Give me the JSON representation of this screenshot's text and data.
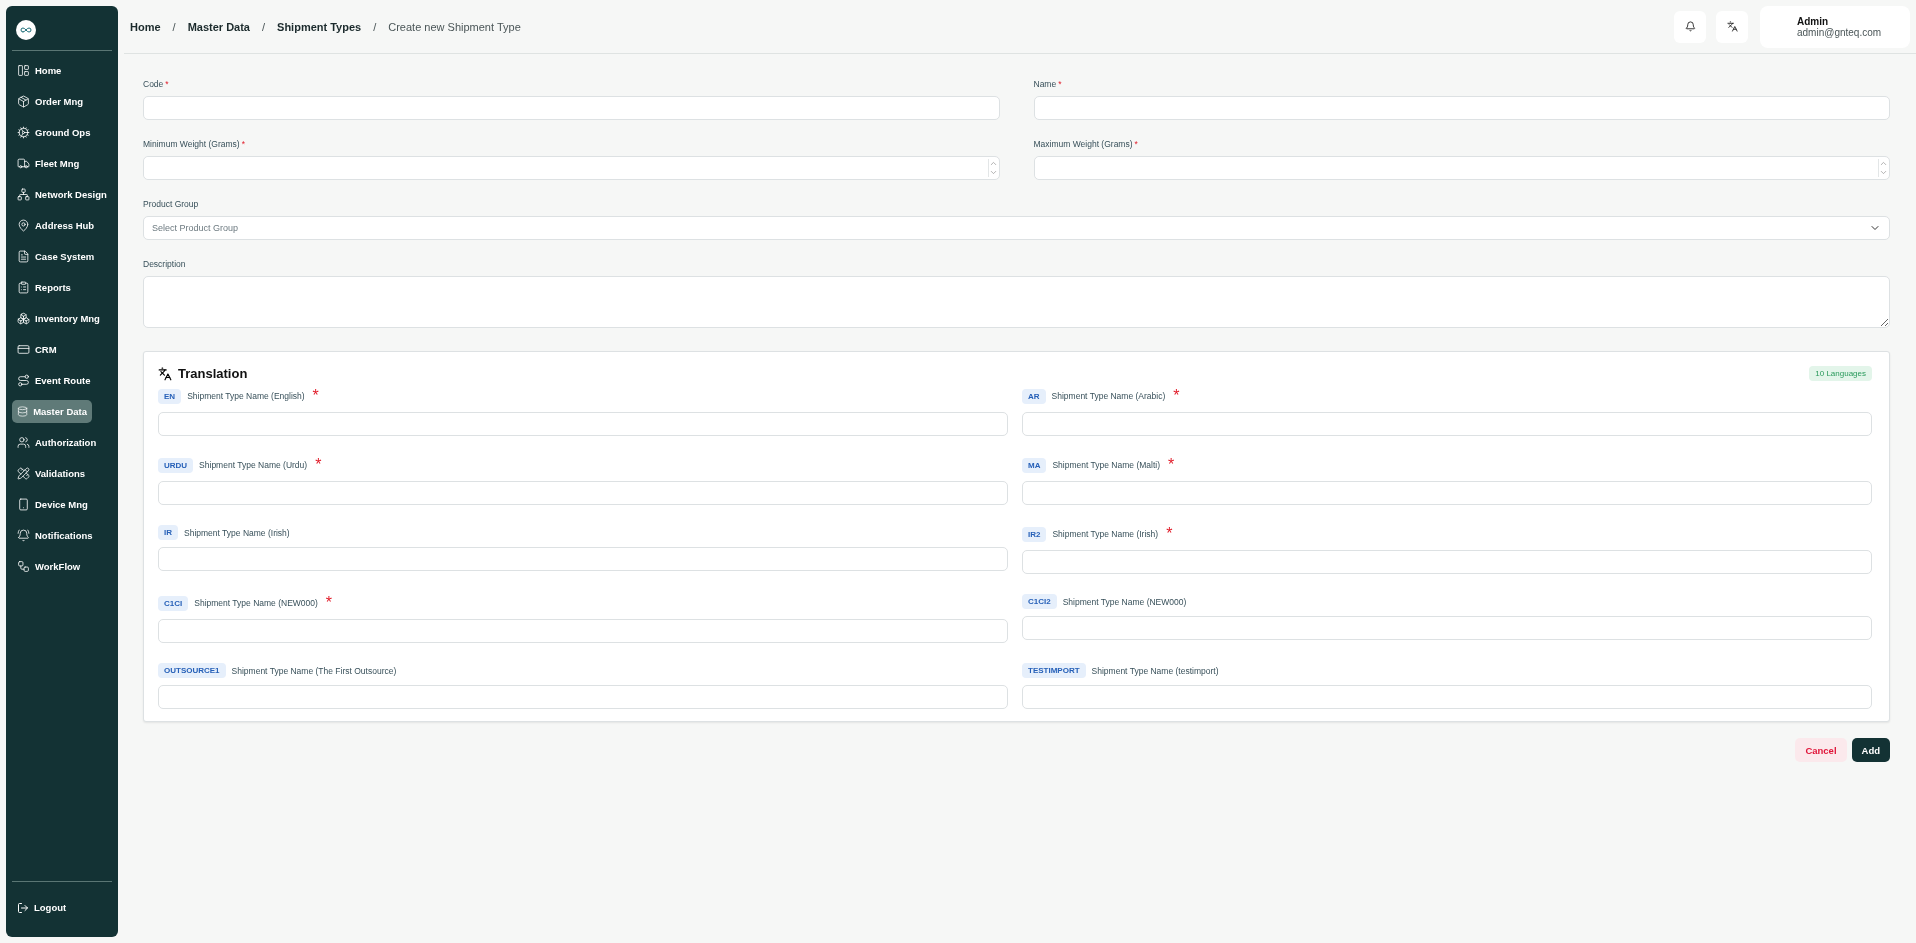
{
  "sidebar": {
    "items": [
      {
        "label": "Home",
        "selected": false
      },
      {
        "label": "Order Mng",
        "selected": false
      },
      {
        "label": "Ground Ops",
        "selected": false
      },
      {
        "label": "Fleet Mng",
        "selected": false
      },
      {
        "label": "Network Design",
        "selected": false
      },
      {
        "label": "Address Hub",
        "selected": false
      },
      {
        "label": "Case System",
        "selected": false
      },
      {
        "label": "Reports",
        "selected": false
      },
      {
        "label": "Inventory Mng",
        "selected": false
      },
      {
        "label": "CRM",
        "selected": false
      },
      {
        "label": "Event Route",
        "selected": false
      },
      {
        "label": "Master Data",
        "selected": true
      },
      {
        "label": "Authorization",
        "selected": false
      },
      {
        "label": "Validations",
        "selected": false
      },
      {
        "label": "Device Mng",
        "selected": false
      },
      {
        "label": "Notifications",
        "selected": false
      },
      {
        "label": "WorkFlow",
        "selected": false
      }
    ],
    "logout": "Logout"
  },
  "breadcrumb": [
    {
      "kind": "link",
      "text": "Home"
    },
    {
      "kind": "separator",
      "text": "/"
    },
    {
      "kind": "link",
      "text": "Master Data"
    },
    {
      "kind": "separator",
      "text": "/"
    },
    {
      "kind": "link",
      "text": "Shipment Types"
    },
    {
      "kind": "separator",
      "text": "/"
    },
    {
      "kind": "current",
      "text": "Create new Shipment Type"
    }
  ],
  "user": {
    "name": "Admin",
    "email": "admin@gnteq.com"
  },
  "form": {
    "fields": [
      {
        "kind": "text",
        "label": "Code",
        "mark": "*"
      },
      {
        "kind": "text",
        "label": "Name",
        "mark": "*"
      },
      {
        "kind": "number",
        "label": "Minimum Weight (Grams)",
        "mark": "*"
      },
      {
        "kind": "number",
        "label": "Maximum Weight (Grams)",
        "mark": "*"
      },
      {
        "kind": "select",
        "label": "Product Group",
        "placeholder": "Select Product Group"
      },
      {
        "kind": "textarea",
        "label": "Description"
      }
    ]
  },
  "translation": {
    "title": "Translation",
    "badge": "10 Languages",
    "fields": [
      {
        "code": "EN",
        "label": "Shipment Type Name (English)",
        "mark": "*"
      },
      {
        "code": "AR",
        "label": "Shipment Type Name (Arabic)",
        "mark": "*"
      },
      {
        "code": "URDU",
        "label": "Shipment Type Name (Urdu)",
        "mark": "*"
      },
      {
        "code": "MA",
        "label": "Shipment Type Name (Malti)",
        "mark": "*"
      },
      {
        "code": "IR",
        "label": "Shipment Type Name (Irish)"
      },
      {
        "code": "IR2",
        "label": "Shipment Type Name (Irish)",
        "mark": "*"
      },
      {
        "code": "C1CI",
        "label": "Shipment Type Name (NEW000)",
        "mark": "*"
      },
      {
        "code": "C1CI2",
        "label": "Shipment Type Name (NEW000)"
      },
      {
        "code": "OUTSOURCE1",
        "label": "Shipment Type Name (The First Outsource)"
      },
      {
        "code": "TESTIMPORT",
        "label": "Shipment Type Name (testimport)"
      }
    ]
  },
  "buttons": [
    {
      "kind": "cancel",
      "label": "Cancel"
    },
    {
      "kind": "primary",
      "label": "Add"
    }
  ]
}
